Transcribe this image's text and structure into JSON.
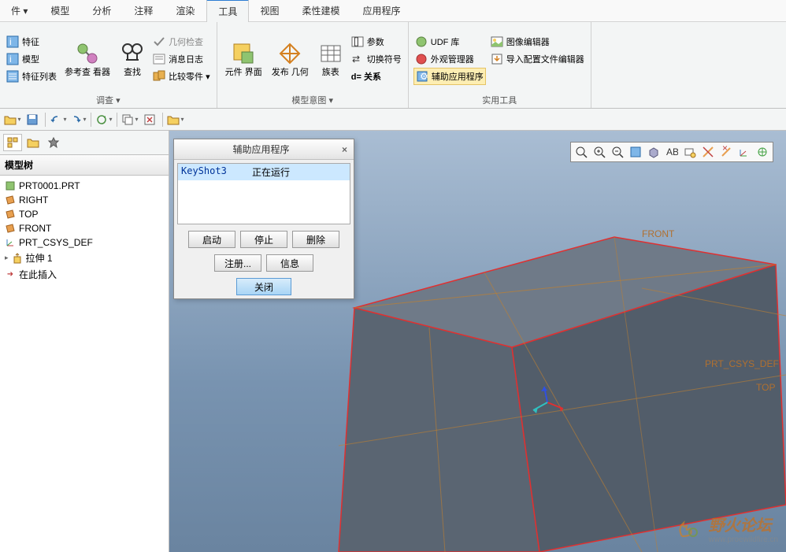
{
  "menubar": {
    "tabs": [
      "件 ▾",
      "模型",
      "分析",
      "注释",
      "渲染",
      "工具",
      "视图",
      "柔性建模",
      "应用程序"
    ],
    "active_index": 5
  },
  "ribbon": {
    "group1": {
      "label": "调查 ▾",
      "items": {
        "feature": "特征",
        "model": "模型",
        "feature_list": "特征列表",
        "ref_viewer": "参考查\n看器",
        "find": "查找",
        "geom_check": "几何检查",
        "msg_log": "消息日志",
        "compare_part": "比较零件 ▾"
      }
    },
    "group2": {
      "label": "模型意图 ▾",
      "items": {
        "comp_interface": "元件\n界面",
        "publish_geom": "发布\n几何",
        "family_table": "族表",
        "params": "参数",
        "switch_sym": "切换符号",
        "relation": "d= 关系"
      }
    },
    "group3": {
      "label": "实用工具",
      "items": {
        "udf_lib": "UDF 库",
        "appearance_mgr": "外观管理器",
        "aux_app": "辅助应用程序",
        "image_editor": "图像编辑器",
        "import_profile": "导入配置文件编辑器"
      }
    }
  },
  "sidebar": {
    "title": "模型树",
    "items": [
      {
        "icon": "part",
        "label": "PRT0001.PRT"
      },
      {
        "icon": "plane",
        "label": "RIGHT"
      },
      {
        "icon": "plane",
        "label": "TOP"
      },
      {
        "icon": "plane",
        "label": "FRONT"
      },
      {
        "icon": "csys",
        "label": "PRT_CSYS_DEF"
      },
      {
        "icon": "feat",
        "label": "拉伸 1"
      },
      {
        "icon": "insert",
        "label": "在此插入"
      }
    ]
  },
  "dialog": {
    "title": "辅助应用程序",
    "list": {
      "name": "KeyShot3",
      "status": "正在运行"
    },
    "btns": {
      "start": "启动",
      "stop": "停止",
      "delete": "删除",
      "register": "注册...",
      "info": "信息",
      "close": "关闭"
    }
  },
  "gfx_labels": {
    "front": "FRONT",
    "top": "TOP",
    "csys": "PRT_CSYS_DEF"
  },
  "watermark": {
    "text": "野火论坛",
    "url": "www.proewildfire.cn"
  }
}
